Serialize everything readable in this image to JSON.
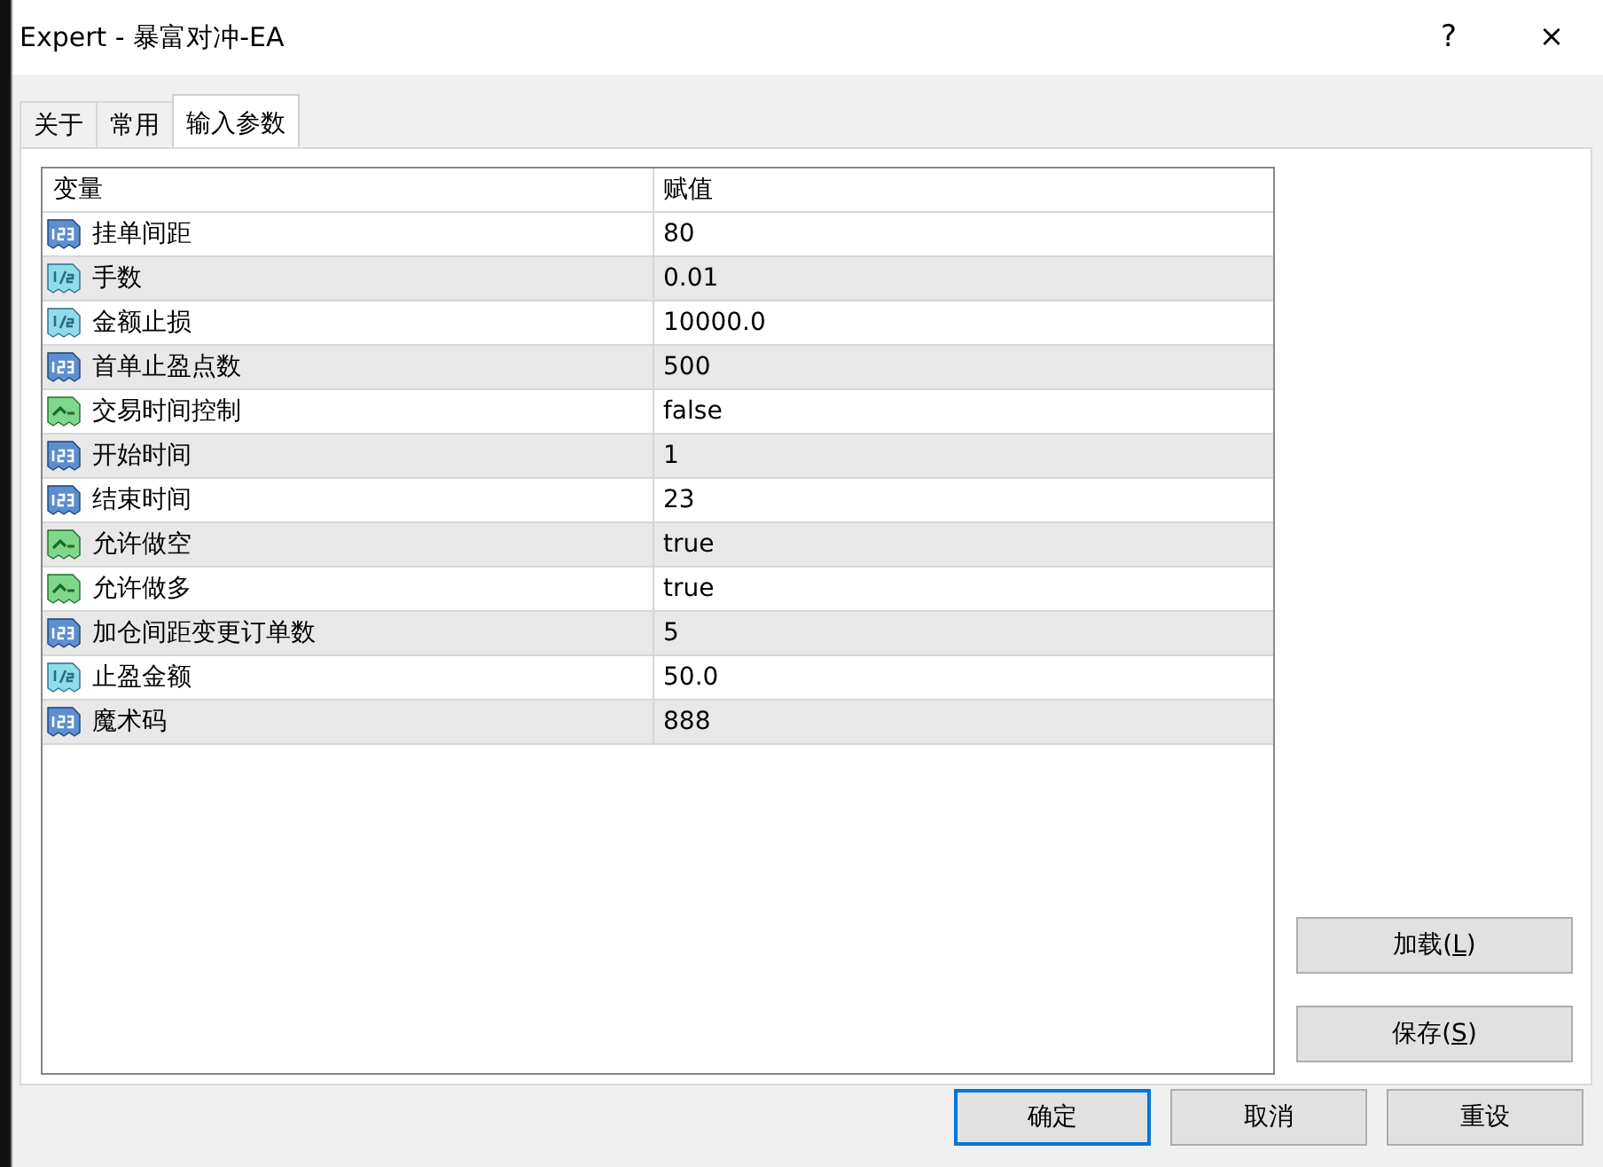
{
  "window": {
    "title": "Expert - 暴富对冲-EA",
    "help": "?",
    "close": "×"
  },
  "tabs": [
    {
      "label": "关于",
      "selected": false
    },
    {
      "label": "常用",
      "selected": false
    },
    {
      "label": "输入参数",
      "selected": true
    }
  ],
  "table": {
    "columns": [
      "变量",
      "赋值"
    ],
    "rows": [
      {
        "kind": "int",
        "name": "挂单间距",
        "value": "80"
      },
      {
        "kind": "double",
        "name": "手数",
        "value": "0.01"
      },
      {
        "kind": "double",
        "name": "金额止损",
        "value": "10000.0"
      },
      {
        "kind": "int",
        "name": "首单止盈点数",
        "value": "500"
      },
      {
        "kind": "bool",
        "name": "交易时间控制",
        "value": "false"
      },
      {
        "kind": "int",
        "name": "开始时间",
        "value": "1"
      },
      {
        "kind": "int",
        "name": "结束时间",
        "value": "23"
      },
      {
        "kind": "bool",
        "name": "允许做空",
        "value": "true"
      },
      {
        "kind": "bool",
        "name": "允许做多",
        "value": "true"
      },
      {
        "kind": "int",
        "name": "加仓间距变更订单数",
        "value": "5"
      },
      {
        "kind": "double",
        "name": "止盈金额",
        "value": "50.0"
      },
      {
        "kind": "int",
        "name": "魔术码",
        "value": "888"
      }
    ]
  },
  "side_buttons": [
    {
      "before": "加载(",
      "accel": "L",
      "after": ")"
    },
    {
      "before": "保存(",
      "accel": "S",
      "after": ")"
    }
  ],
  "buttons": [
    {
      "label": "确定",
      "default": true
    },
    {
      "label": "取消",
      "default": false
    },
    {
      "label": "重设",
      "default": false
    }
  ]
}
